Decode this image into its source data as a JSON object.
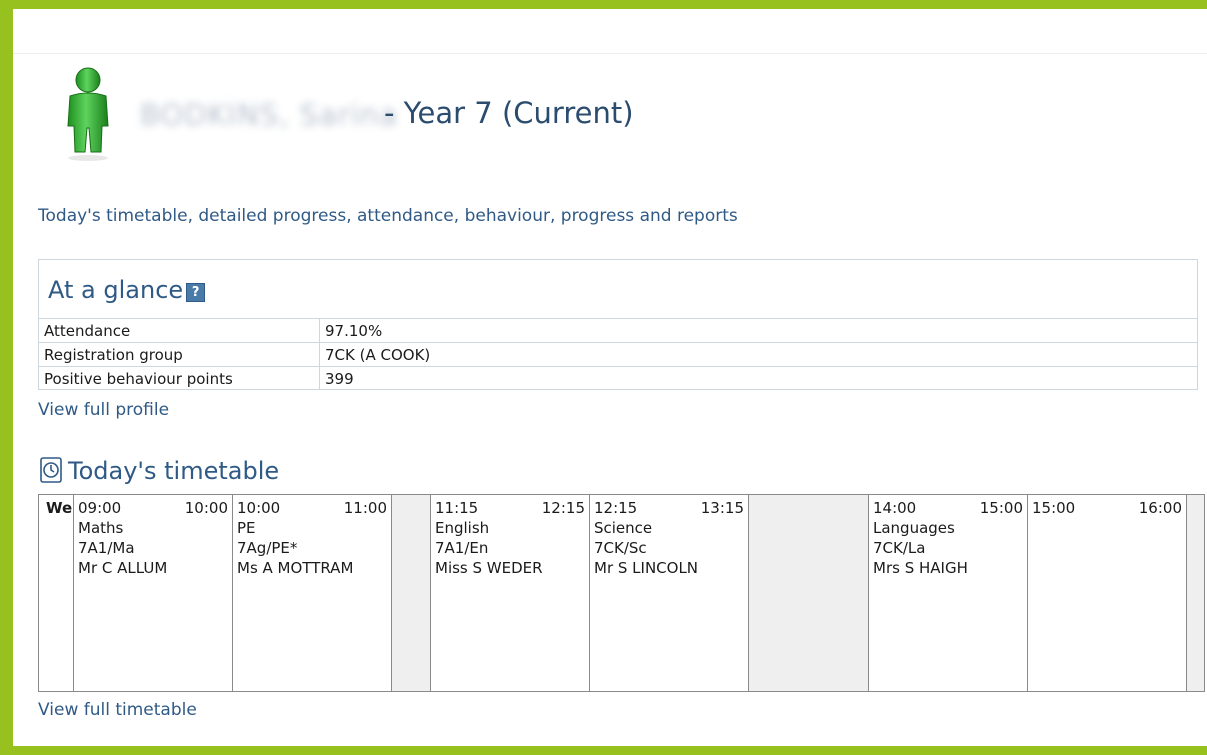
{
  "student": {
    "name": "BODKINS, Sarina",
    "title": "- Year 7 (Current)"
  },
  "intro_link": "Today's timetable, detailed progress, attendance, behaviour, progress and reports",
  "glance": {
    "title": "At a glance",
    "help_icon": "?",
    "rows": [
      {
        "label": "Attendance",
        "value": "97.10%"
      },
      {
        "label": "Registration group",
        "value": "7CK (A COOK)"
      },
      {
        "label": "Positive behaviour points",
        "value": "399"
      }
    ],
    "view_link": "View full profile"
  },
  "timetable": {
    "title": "Today's timetable",
    "day": "We",
    "periods": [
      {
        "start": "09:00",
        "end": "10:00",
        "subject": "Maths",
        "group": "7A1/Ma",
        "teacher": "Mr C ALLUM"
      },
      {
        "start": "10:00",
        "end": "11:00",
        "subject": "PE",
        "group": "7Ag/PE*",
        "teacher": "Ms A MOTTRAM"
      },
      {
        "start": "11:15",
        "end": "12:15",
        "subject": "English",
        "group": "7A1/En",
        "teacher": "Miss S WEDER"
      },
      {
        "start": "12:15",
        "end": "13:15",
        "subject": "Science",
        "group": "7CK/Sc",
        "teacher": "Mr S LINCOLN"
      },
      {
        "start": "14:00",
        "end": "15:00",
        "subject": "Languages",
        "group": "7CK/La",
        "teacher": "Mrs S HAIGH"
      },
      {
        "start": "15:00",
        "end": "16:00",
        "subject": "",
        "group": "",
        "teacher": ""
      }
    ],
    "view_link": "View full timetable"
  },
  "colors": {
    "frame": "#96c11f",
    "link": "#2f5a86",
    "avatar": "#3db33d"
  },
  "icons": {
    "avatar": "person-icon",
    "help": "help-icon",
    "timetable": "clock-icon"
  }
}
